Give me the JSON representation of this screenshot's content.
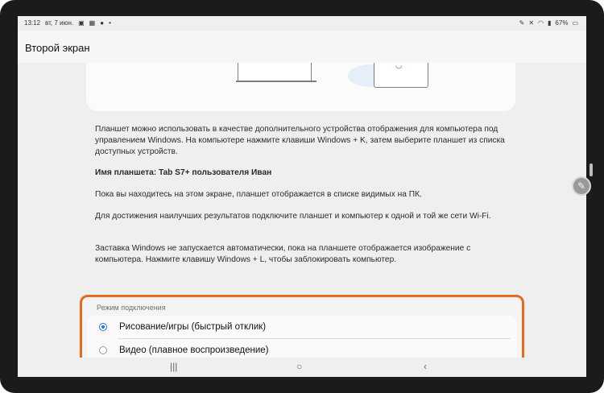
{
  "status_bar": {
    "time": "13:12",
    "date": "вт, 7 июн.",
    "left_icons": [
      "image-icon",
      "calendar-icon",
      "notification-icon",
      "dot-icon"
    ],
    "right_icons": [
      "pen-icon",
      "mute-icon",
      "wifi-icon",
      "signal-icon"
    ],
    "battery": "67%"
  },
  "appbar": {
    "title": "Второй экран"
  },
  "body": {
    "para1": "Планшет можно использовать в качестве дополнительного устройства отображения для компьютера под управлением Windows. На компьютере нажмите клавиши Windows + K, затем выберите планшет из списка доступных устройств.",
    "device_name": "Имя планшета: Tab S7+ пользователя Иван",
    "para2": "Пока вы находитесь на этом экране, планшет отображается в списке видимых на ПК.",
    "para3": "Для достижения наилучших результатов подключите планшет и компьютер к одной и той же сети Wi-Fi.",
    "para4": "Заставка Windows не запускается автоматически, пока на планшете отображается изображение с компьютера. Нажмите клавишу Windows + L, чтобы заблокировать компьютер."
  },
  "connection_mode": {
    "label": "Режим подключения",
    "options": [
      {
        "label": "Рисование/игры (быстрый отклик)",
        "selected": true
      },
      {
        "label": "Видео (плавное воспроизведение)",
        "selected": false
      }
    ],
    "highlight_color": "#e86a1a",
    "accent_color": "#2f6fe8"
  },
  "navbar": {
    "recents": "|||",
    "home": "○",
    "back": "‹"
  }
}
